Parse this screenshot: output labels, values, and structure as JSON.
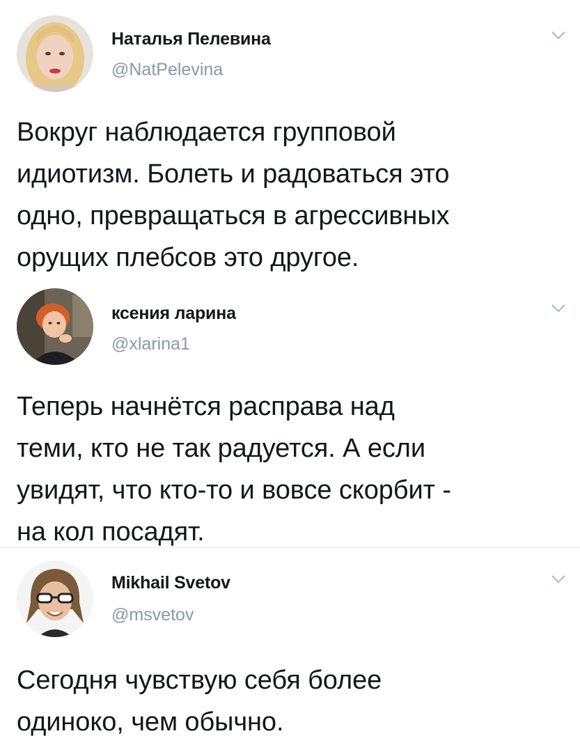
{
  "colors": {
    "text": "#14171a",
    "secondary": "#8899a6",
    "divider": "#e6ecf0"
  },
  "tweets": [
    {
      "display_name": "Наталья Пелевина",
      "handle": "@NatPelevina",
      "avatar_icon": "avatar-blonde-woman",
      "menu_icon": "chevron-down-icon",
      "text": "Вокруг наблюдается групповой\nидиотизм. Болеть и радоваться это\nодно, превращаться в агрессивных\nорущих плебсов это другое."
    },
    {
      "display_name": "ксения ларина",
      "handle": "@xlarina1",
      "avatar_icon": "avatar-redhead-woman",
      "menu_icon": "chevron-down-icon",
      "text": "Теперь начнётся расправа над\nтеми, кто не так радуется. А если\nувидят, что кто-то и вовсе скорбит -\nна кол посадят."
    },
    {
      "display_name": "Mikhail Svetov",
      "handle": "@msvetov",
      "avatar_icon": "avatar-man-sunglasses",
      "menu_icon": "chevron-down-icon",
      "text": "Сегодня чувствую себя более\nодиноко, чем обычно."
    }
  ]
}
